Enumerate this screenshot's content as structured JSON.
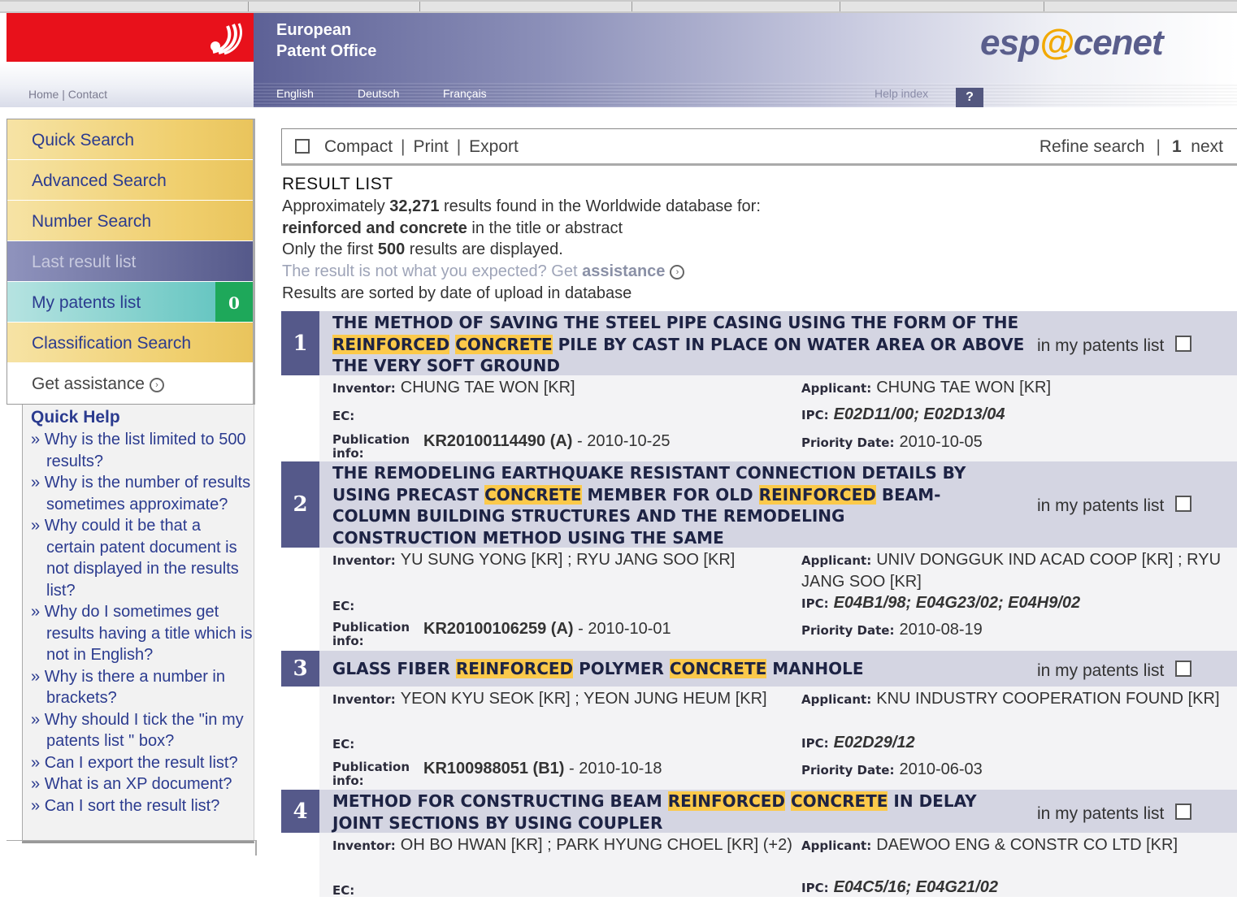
{
  "header": {
    "org_line1": "European",
    "org_line2": "Patent Office",
    "home_contact": "Home | Contact",
    "languages": [
      "English",
      "Deutsch",
      "Français"
    ],
    "help_index": "Help index",
    "help_q": "?",
    "brand_pre": "esp",
    "brand_ac": "@",
    "brand_post": "cenet"
  },
  "sidebar": {
    "items": [
      {
        "label": "Quick Search"
      },
      {
        "label": "Advanced Search"
      },
      {
        "label": "Number Search"
      },
      {
        "label": "Last result list"
      },
      {
        "label": "My patents list",
        "badge": "0"
      },
      {
        "label": "Classification Search"
      },
      {
        "label": "Get assistance"
      }
    ]
  },
  "quick_help": {
    "title": "Quick Help",
    "items": [
      "Why is the list limited to 500 results?",
      "Why is the number of results sometimes approximate?",
      "Why could it be that a certain patent document is not displayed in the results list?",
      "Why do I sometimes get results having a title which is not in English?",
      "Why is there a number in brackets?",
      "Why should I tick the \"in my patents list \" box?",
      "Can I export the result list?",
      "What is an XP document?",
      "Can I sort the result list?"
    ]
  },
  "toolbar": {
    "compact": "Compact",
    "print": "Print",
    "export": "Export",
    "refine": "Refine search",
    "page": "1",
    "next": "next"
  },
  "results_header": {
    "title": "RESULT LIST",
    "line1_pre": "Approximately",
    "count": "32,271",
    "line1_post": "results found in the Worldwide database for:",
    "query": "reinforced and concrete",
    "line2_post": "in the title or abstract",
    "line3_pre": "Only the first",
    "limit": "500",
    "line3_post": "results are displayed.",
    "assist_pre": "The result is not what you expected? Get",
    "assist_link": "assistance",
    "sorted": "Results are sorted by date of upload in database"
  },
  "labels": {
    "inventor": "Inventor:",
    "applicant": "Applicant:",
    "ec": "EC:",
    "ipc": "IPC:",
    "publication": "Publication info:",
    "priority": "Priority Date:",
    "in_list": "in my patents list"
  },
  "results": [
    {
      "num": "1",
      "title_parts": [
        {
          "t": "THE METHOD OF SAVING THE STEEL PIPE CASING USING THE FORM OF THE "
        },
        {
          "t": "REINFORCED",
          "hl": true
        },
        {
          "t": " "
        },
        {
          "t": "CONCRETE",
          "hl": true
        },
        {
          "t": " PILE BY CAST IN PLACE ON WATER AREA OR ABOVE THE VERY SOFT GROUND"
        }
      ],
      "inventor": "CHUNG TAE WON [KR]",
      "applicant": "CHUNG TAE WON [KR]",
      "ec": "",
      "ipc": "E02D11/00; E02D13/04",
      "pub_num": "KR20100114490 (A)",
      "pub_date": "- 2010-10-25",
      "priority": "2010-10-05"
    },
    {
      "num": "2",
      "title_parts": [
        {
          "t": "THE REMODELING EARTHQUAKE RESISTANT CONNECTION DETAILS BY USING PRECAST "
        },
        {
          "t": "CONCRETE",
          "hl": true
        },
        {
          "t": " MEMBER FOR OLD "
        },
        {
          "t": "REINFORCED",
          "hl": true
        },
        {
          "t": " BEAM-COLUMN BUILDING STRUCTURES AND THE REMODELING CONSTRUCTION METHOD USING THE SAME"
        }
      ],
      "inventor": "YU SUNG YONG [KR] ; RYU JANG SOO [KR]",
      "applicant": "UNIV DONGGUK IND ACAD COOP [KR] ; RYU JANG SOO [KR]",
      "ec": "",
      "ipc": "E04B1/98; E04G23/02; E04H9/02",
      "pub_num": "KR20100106259 (A)",
      "pub_date": "- 2010-10-01",
      "priority": "2010-08-19"
    },
    {
      "num": "3",
      "title_parts": [
        {
          "t": "GLASS FIBER "
        },
        {
          "t": "REINFORCED",
          "hl": true
        },
        {
          "t": " POLYMER "
        },
        {
          "t": "CONCRETE",
          "hl": true
        },
        {
          "t": " MANHOLE"
        }
      ],
      "inventor": "YEON KYU SEOK [KR] ; YEON JUNG HEUM [KR]",
      "applicant": "KNU INDUSTRY COOPERATION FOUND [KR]",
      "ec": "",
      "ipc": "E02D29/12",
      "pub_num": "KR100988051 (B1)",
      "pub_date": "- 2010-10-18",
      "priority": "2010-06-03"
    },
    {
      "num": "4",
      "title_parts": [
        {
          "t": "METHOD FOR CONSTRUCTING BEAM "
        },
        {
          "t": "REINFORCED",
          "hl": true
        },
        {
          "t": " "
        },
        {
          "t": "CONCRETE",
          "hl": true
        },
        {
          "t": " IN DELAY JOINT SECTIONS BY USING COUPLER"
        }
      ],
      "inventor": "OH BO HWAN [KR] ; PARK HYUNG CHOEL [KR] (+2)",
      "applicant": "DAEWOO ENG & CONSTR CO LTD [KR]",
      "ec": "",
      "ipc": "E04C5/16; E04G21/02"
    }
  ]
}
